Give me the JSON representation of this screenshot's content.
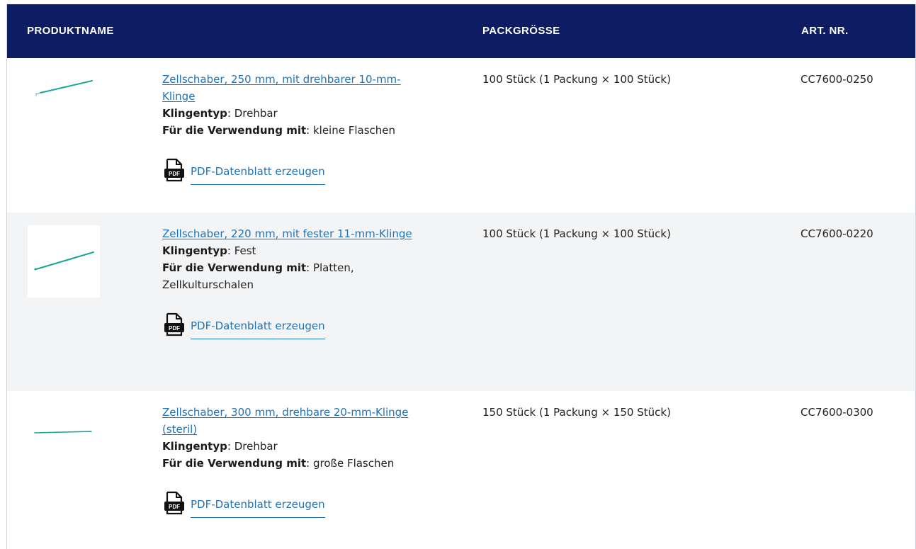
{
  "table": {
    "headers": {
      "name": "PRODUKTNAME",
      "pack": "PACKGRÖSSE",
      "art": "ART. NR."
    },
    "rows": [
      {
        "product_name": "Zellschaber, 250 mm, mit drehbarer 10-mm-Klinge",
        "blade_label": "Klingentyp",
        "blade_value": ": Drehbar",
        "use_label": "Für die Verwendung mit",
        "use_value": ": kleine Flaschen",
        "pdf_label": "PDF-Datenblatt erzeugen",
        "pack_size": "100 Stück (1 Packung × 100 Stück)",
        "art_nr": "CC7600-0250",
        "thumb_icon": "cell-scraper-image"
      },
      {
        "product_name": "Zellschaber, 220 mm, mit fester 11-mm-Klinge",
        "blade_label": "Klingentyp",
        "blade_value": ": Fest",
        "use_label": "Für die Verwendung mit",
        "use_value": ": Platten, Zellkulturschalen",
        "pdf_label": "PDF-Datenblatt erzeugen",
        "pack_size": "100 Stück (1 Packung × 100 Stück)",
        "art_nr": "CC7600-0220",
        "thumb_icon": "cell-scraper-image"
      },
      {
        "product_name": "Zellschaber, 300 mm, drehbare 20-mm-Klinge (steril)",
        "blade_label": "Klingentyp",
        "blade_value": ": Drehbar",
        "use_label": "Für die Verwendung mit",
        "use_value": ": große Flaschen",
        "pdf_label": "PDF-Datenblatt erzeugen",
        "pack_size": "150 Stück (1 Packung × 150 Stück)",
        "art_nr": "CC7600-0300",
        "thumb_icon": "cell-scraper-image"
      }
    ]
  },
  "colors": {
    "header_bg": "#0e1c63",
    "link": "#1f72b8",
    "row_alt_bg": "#f3f4f6",
    "scraper_teal": "#1aa39a"
  },
  "icons": {
    "pdf": "pdf-document-icon"
  }
}
